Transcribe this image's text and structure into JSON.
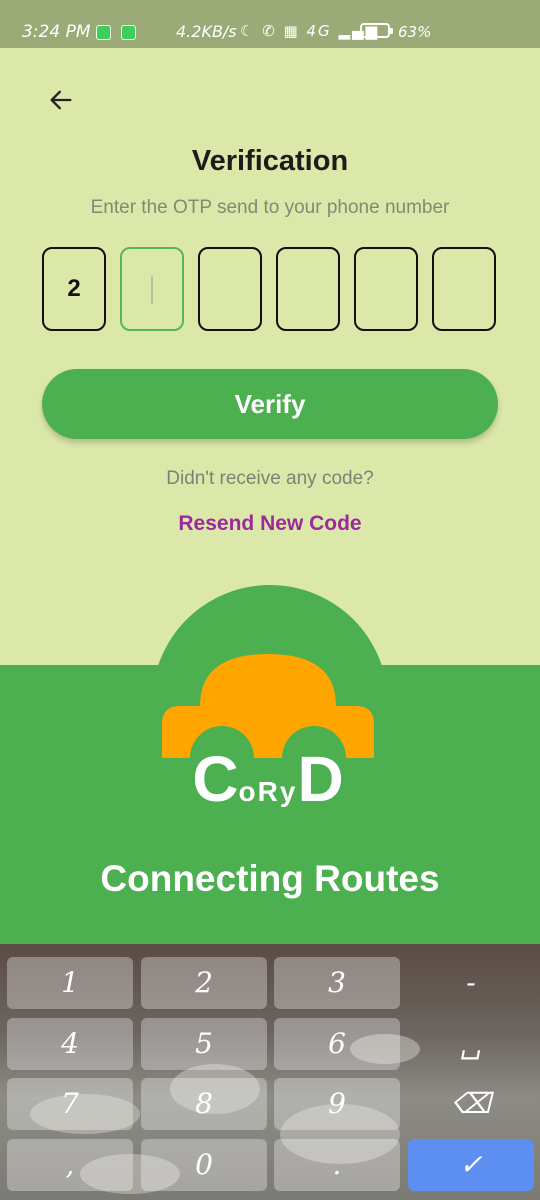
{
  "status_bar": {
    "time": "3:24 PM",
    "network_speed": "4.2KB/s",
    "signal": "4G",
    "battery_percent": "63%"
  },
  "screen": {
    "title": "Verification",
    "subtitle": "Enter the OTP send to your phone number",
    "otp_digits": [
      "2",
      "",
      "",
      "",
      "",
      ""
    ],
    "verify_label": "Verify",
    "no_code_text": "Didn't receive any code?",
    "resend_label": "Resend New Code"
  },
  "brand": {
    "logo_text_big_c": "C",
    "logo_text_small": "oRy",
    "logo_text_big_d": "D",
    "tagline": "Connecting Routes",
    "colors": {
      "primary": "#4caf50",
      "accent_orange": "#ffa500",
      "background": "#dbe8a9",
      "link_purple": "#9b2a9c"
    }
  },
  "keyboard": {
    "rows": [
      [
        "1",
        "2",
        "3",
        "-"
      ],
      [
        "4",
        "5",
        "6",
        "␣"
      ],
      [
        "7",
        "8",
        "9",
        "⌫"
      ],
      [
        ",",
        "0",
        ".",
        "✓"
      ]
    ]
  }
}
